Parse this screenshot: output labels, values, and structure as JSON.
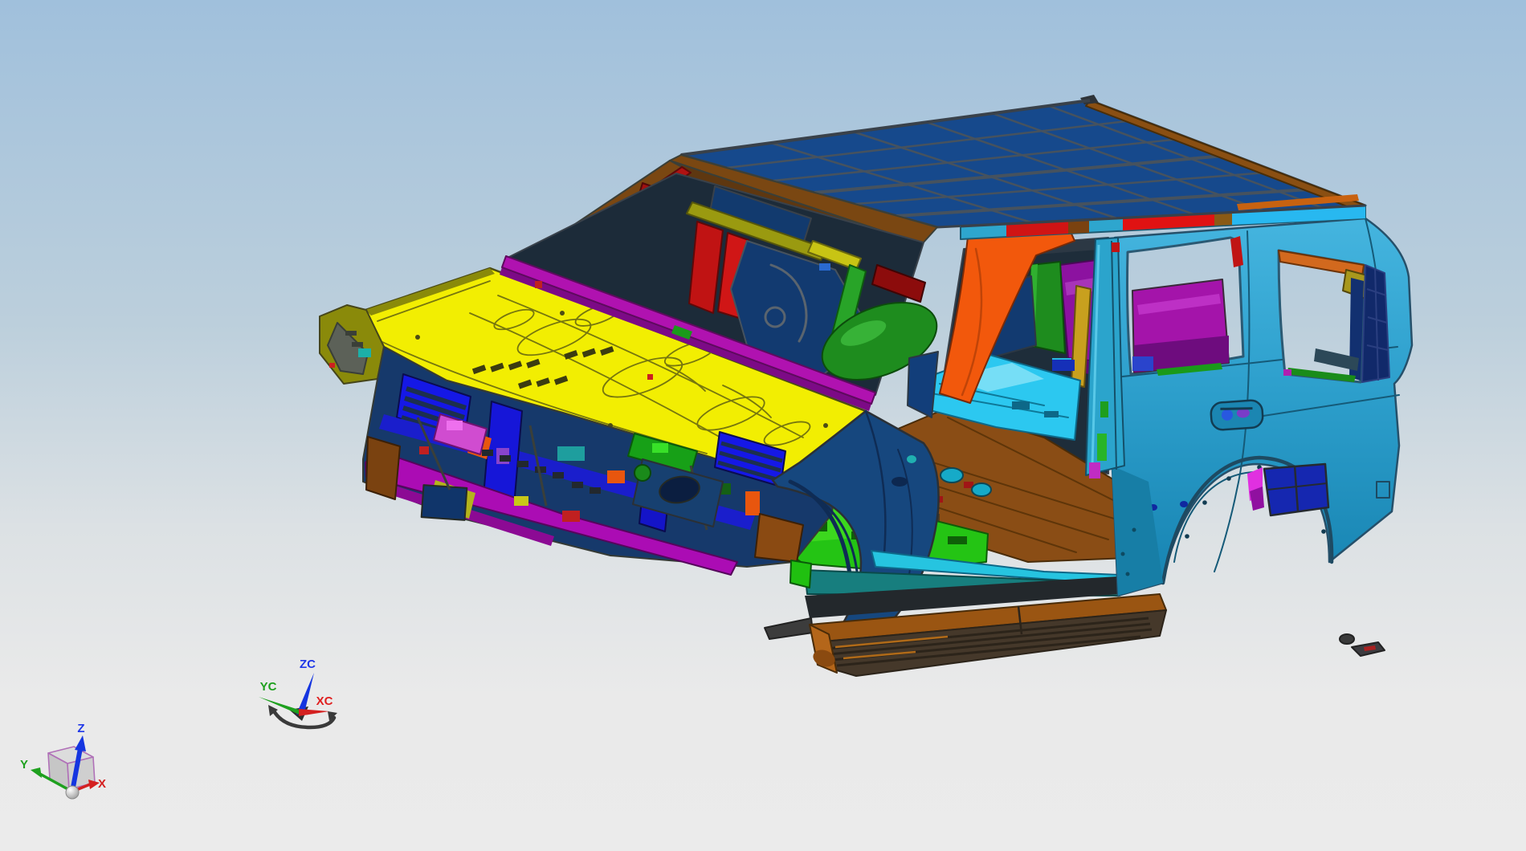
{
  "viewport": {
    "application": "cad-3d-viewport",
    "content": "vehicle body-in-white shaded model, isometric front-left elevated view",
    "background_top": "#a0c0dc",
    "background_bottom": "#ebebeb"
  },
  "model": {
    "name": "suv-body-in-white",
    "parts": [
      "roof panel",
      "hood",
      "windshield header",
      "A-pillar",
      "B-pillar",
      "front fender",
      "body side",
      "rear quarter panel",
      "rear wheel arch",
      "floor pan",
      "rocker sill",
      "running board",
      "cowl vent panel",
      "D-pillar",
      "radiator support",
      "bumper rail"
    ]
  },
  "view_triad": {
    "x_label": "X",
    "y_label": "Y",
    "z_label": "Z",
    "x_color": "#d42020",
    "y_color": "#1ea01e",
    "z_color": "#2038e8"
  },
  "wcs_triad": {
    "xc_label": "XC",
    "yc_label": "YC",
    "zc_label": "ZC",
    "x_color": "#e02020",
    "y_color": "#1ea01e",
    "z_color": "#2038e8"
  },
  "palette": {
    "roof_blue": "#16498c",
    "header_brown": "#7a4712",
    "hood_yellow": "#f2ee02",
    "cowl_magenta": "#b012b0",
    "fender_olive": "#8a8a0a",
    "fender_navy": "#16477e",
    "grille_blue": "#1518e6",
    "bumper_magenta": "#ab0cb4",
    "apillar_orange": "#f2580c",
    "floor_green": "#24c414",
    "floor_brown": "#8a4d15",
    "floor_cyan": "#2cc8f0",
    "body_cyan": "#2d9fcc",
    "rail_red": "#e01212",
    "sill_teal": "#177e7e",
    "sill_cyan": "#26c4e0",
    "running_board_brown": "#9a5512",
    "dpillar_navy": "#11296a",
    "wheelhouse_magenta": "#a414aa",
    "seat_navy": "#123a70",
    "engine_green": "#1e8c1e"
  }
}
